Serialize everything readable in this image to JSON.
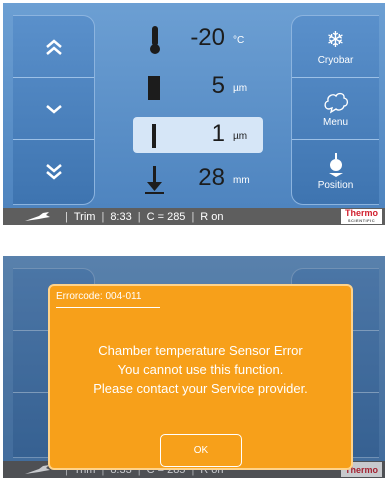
{
  "colors": {
    "panel_blue": "#4f84bd",
    "status_gray": "#5e5e5e",
    "dialog_orange": "#f7a01a",
    "thermo_red": "#d1202f"
  },
  "left_nav": {
    "up_fast_icon": "double-chevron-up-icon",
    "down_icon": "chevron-down-icon",
    "down_fast_icon": "double-chevron-down-icon"
  },
  "readouts": [
    {
      "icon": "thermometer-icon",
      "value": "-20",
      "unit": "°C"
    },
    {
      "icon": "section-thickness-icon",
      "value": "5",
      "unit": "µm"
    },
    {
      "icon": "trim-thickness-icon",
      "value": "1",
      "unit": "µm",
      "selected": true
    },
    {
      "icon": "position-arrow-icon",
      "value": "28",
      "unit": "mm"
    }
  ],
  "right_menu": {
    "cryobar": "Cryobar",
    "menu": "Menu",
    "position": "Position"
  },
  "status": {
    "mode": "Trim",
    "time": "8:33",
    "counter": "C = 285",
    "retract": "R on",
    "brand": "Thermo",
    "brand_sub": "SCIENTIFIC"
  },
  "dialog": {
    "code": "Errorcode: 004-011",
    "line1": "Chamber temperature Sensor Error",
    "line2": "You cannot use this function.",
    "line3": "Please contact your Service provider.",
    "ok": "OK"
  }
}
